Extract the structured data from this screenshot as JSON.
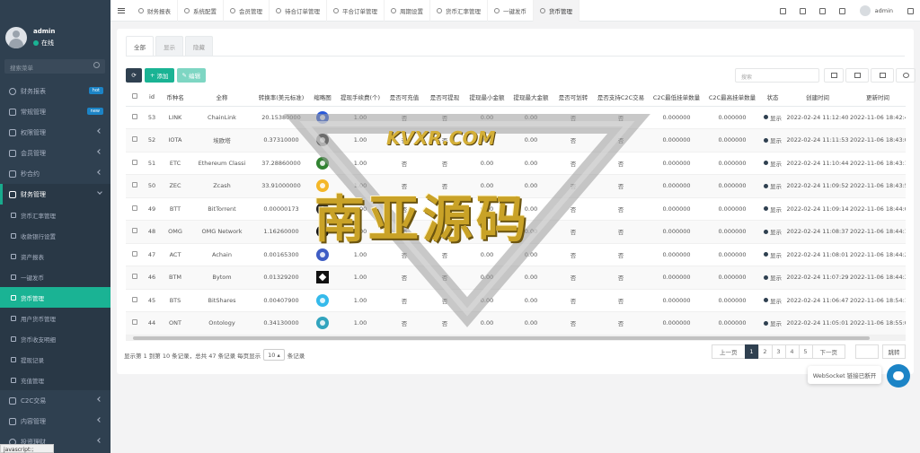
{
  "sidebar": {
    "user": {
      "name": "admin",
      "status": "在线"
    },
    "search_placeholder": "搜索菜单",
    "items": [
      {
        "label": "财务报表",
        "badge": "hot"
      },
      {
        "label": "常规管理",
        "badge": "new"
      },
      {
        "label": "权限管理"
      },
      {
        "label": "会员管理"
      },
      {
        "label": "秒合约"
      },
      {
        "label": "财务管理"
      }
    ],
    "sub_items": [
      {
        "label": "货币汇率管理"
      },
      {
        "label": "收款银行设置"
      },
      {
        "label": "资产报表"
      },
      {
        "label": "一键发币"
      },
      {
        "label": "货币管理"
      },
      {
        "label": "用户货币管理"
      },
      {
        "label": "货币收支明细"
      },
      {
        "label": "提现记录"
      },
      {
        "label": "充值管理"
      }
    ],
    "bottom_items": [
      {
        "label": "C2C交易"
      },
      {
        "label": "内容管理"
      },
      {
        "label": "投资理财"
      }
    ],
    "status_bar": "javascript:;"
  },
  "topbar": {
    "tabs": [
      "财务报表",
      "系统配置",
      "会员管理",
      "待合订单管理",
      "平合订单管理",
      "周期设置",
      "货币汇率管理",
      "一键发币",
      "货币管理"
    ],
    "user": "admin"
  },
  "panel": {
    "tabs": [
      "全部",
      "显示",
      "隐藏"
    ],
    "add_label": "添加",
    "edit_label": "编辑",
    "search_placeholder": "搜索"
  },
  "table": {
    "headers": [
      "",
      "id",
      "币种名",
      "全称",
      "转换率(美元标准)",
      "缩略图",
      "提现手续费(个)",
      "是否可充值",
      "是否可提现",
      "提现最小金额",
      "提现最大金额",
      "是否可划转",
      "是否支持C2C交易",
      "C2C最低挂单数量",
      "C2C最高挂单数量",
      "状态",
      "创建时间",
      "更新时间"
    ],
    "rows": [
      {
        "id": "53",
        "symbol": "LINK",
        "name": "ChainLink",
        "rate": "20.15380000",
        "fee": "1.00",
        "deposit": "否",
        "withdraw": "否",
        "min": "0.00",
        "max": "0.00",
        "transfer": "否",
        "c2c": "否",
        "c2c_min": "0.000000",
        "c2c_max": "0.000000",
        "status": "显示",
        "created": "2022-02-24 11:12:40",
        "updated": "2022-11-06 18:42:48",
        "color": "#2a5ada",
        "shape": "dot"
      },
      {
        "id": "52",
        "symbol": "IOTA",
        "name": "埃欧塔",
        "rate": "0.37310000",
        "fee": "1.00",
        "deposit": "否",
        "withdraw": "否",
        "min": "0.00",
        "max": "0.00",
        "transfer": "否",
        "c2c": "否",
        "c2c_min": "0.000000",
        "c2c_max": "0.000000",
        "status": "显示",
        "created": "2022-02-24 11:11:53",
        "updated": "2022-11-06 18:43:06",
        "color": "#333333",
        "shape": "dot"
      },
      {
        "id": "51",
        "symbol": "ETC",
        "name": "Ethereum Classi",
        "rate": "37.28860000",
        "fee": "1.00",
        "deposit": "否",
        "withdraw": "否",
        "min": "0.00",
        "max": "0.00",
        "transfer": "否",
        "c2c": "否",
        "c2c_min": "0.000000",
        "c2c_max": "0.000000",
        "status": "显示",
        "created": "2022-02-24 11:10:44",
        "updated": "2022-11-06 18:43:13",
        "color": "#328332",
        "shape": "dot"
      },
      {
        "id": "50",
        "symbol": "ZEC",
        "name": "Zcash",
        "rate": "33.91000000",
        "fee": "1.00",
        "deposit": "否",
        "withdraw": "否",
        "min": "0.00",
        "max": "0.00",
        "transfer": "否",
        "c2c": "否",
        "c2c_min": "0.000000",
        "c2c_max": "0.000000",
        "status": "显示",
        "created": "2022-02-24 11:09:52",
        "updated": "2022-11-06 18:43:56",
        "color": "#f4b728",
        "shape": "dot"
      },
      {
        "id": "49",
        "symbol": "BTT",
        "name": "BitTorrent",
        "rate": "0.00000173",
        "fee": "1.00",
        "deposit": "否",
        "withdraw": "否",
        "min": "0.00",
        "max": "0.00",
        "transfer": "否",
        "c2c": "否",
        "c2c_min": "0.000000",
        "c2c_max": "0.000000",
        "status": "显示",
        "created": "2022-02-24 11:09:14",
        "updated": "2022-11-06 18:44:05",
        "color": "#222222",
        "shape": "dot"
      },
      {
        "id": "48",
        "symbol": "OMG",
        "name": "OMG Network",
        "rate": "1.16260000",
        "fee": "1.00",
        "deposit": "否",
        "withdraw": "否",
        "min": "0.00",
        "max": "0.00",
        "transfer": "否",
        "c2c": "否",
        "c2c_min": "0.000000",
        "c2c_max": "0.000000",
        "status": "显示",
        "created": "2022-02-24 11:08:37",
        "updated": "2022-11-06 18:44:16",
        "color": "#101010",
        "shape": "dot"
      },
      {
        "id": "47",
        "symbol": "ACT",
        "name": "Achain",
        "rate": "0.00165300",
        "fee": "1.00",
        "deposit": "否",
        "withdraw": "否",
        "min": "0.00",
        "max": "0.00",
        "transfer": "否",
        "c2c": "否",
        "c2c_min": "0.000000",
        "c2c_max": "0.000000",
        "status": "显示",
        "created": "2022-02-24 11:08:01",
        "updated": "2022-11-06 18:44:24",
        "color": "#3f5dc4",
        "shape": "dot"
      },
      {
        "id": "46",
        "symbol": "BTM",
        "name": "Bytom",
        "rate": "0.01329200",
        "fee": "1.00",
        "deposit": "否",
        "withdraw": "否",
        "min": "0.00",
        "max": "0.00",
        "transfer": "否",
        "c2c": "否",
        "c2c_min": "0.000000",
        "c2c_max": "0.000000",
        "status": "显示",
        "created": "2022-02-24 11:07:29",
        "updated": "2022-11-06 18:44:32",
        "color": "#111111",
        "shape": "square"
      },
      {
        "id": "45",
        "symbol": "BTS",
        "name": "BitShares",
        "rate": "0.00407900",
        "fee": "1.00",
        "deposit": "否",
        "withdraw": "否",
        "min": "0.00",
        "max": "0.00",
        "transfer": "否",
        "c2c": "否",
        "c2c_min": "0.000000",
        "c2c_max": "0.000000",
        "status": "显示",
        "created": "2022-02-24 11:06:47",
        "updated": "2022-11-06 18:54:19",
        "color": "#35baeb",
        "shape": "dot"
      },
      {
        "id": "44",
        "symbol": "ONT",
        "name": "Ontology",
        "rate": "0.34130000",
        "fee": "1.00",
        "deposit": "否",
        "withdraw": "否",
        "min": "0.00",
        "max": "0.00",
        "transfer": "否",
        "c2c": "否",
        "c2c_min": "0.000000",
        "c2c_max": "0.000000",
        "status": "显示",
        "created": "2022-02-24 11:05:01",
        "updated": "2022-11-06 18:55:05",
        "color": "#32a4be",
        "shape": "dot"
      }
    ]
  },
  "pagination": {
    "info_prefix": "显示第 1 到第 10 条记录，总共 47 条记录 每页显示",
    "page_size": "10",
    "info_suffix": "条记录",
    "prev": "上一页",
    "pages": [
      "1",
      "2",
      "3",
      "4",
      "5"
    ],
    "active_page": "1",
    "next": "下一页",
    "jump": "跳转"
  },
  "toast": "WebSocket 链接已断开",
  "watermark": {
    "url": "KVXR.COM",
    "text": "南亚源码"
  }
}
